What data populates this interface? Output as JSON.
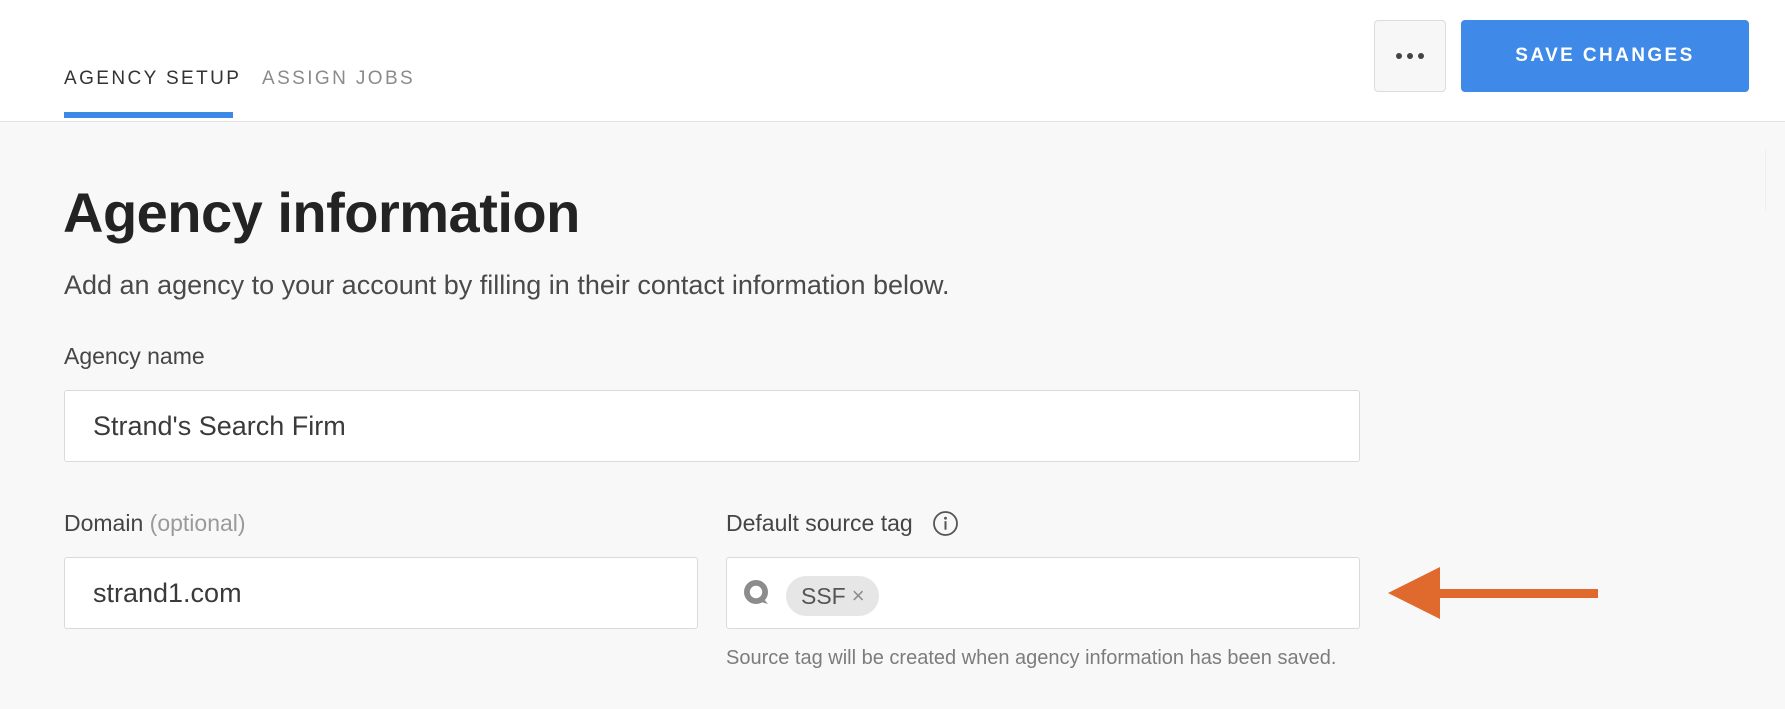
{
  "tabs": [
    {
      "label": "AGENCY SETUP",
      "active": true
    },
    {
      "label": "ASSIGN JOBS",
      "active": false
    }
  ],
  "header": {
    "more_icon": "ellipsis-horizontal-icon",
    "save_label": "SAVE CHANGES"
  },
  "main": {
    "title": "Agency information",
    "subtitle": "Add an agency to your account by filling in their contact information below."
  },
  "form": {
    "agency_name": {
      "label": "Agency name",
      "value": "Strand's Search Firm"
    },
    "domain": {
      "label": "Domain",
      "optional_label": "(optional)",
      "value": "strand1.com"
    },
    "source_tag": {
      "label": "Default source tag",
      "field_icon": "search-icon",
      "info_icon": "info-icon",
      "tags": [
        {
          "label": "SSF",
          "remove_icon": "close-icon",
          "remove_glyph": "×"
        }
      ],
      "helper_text": "Source tag will be created when agency information has been saved."
    }
  },
  "annotation": {
    "icon": "arrow-left-icon",
    "color": "#e06a2e"
  },
  "colors": {
    "accent": "#3f8ae8",
    "background": "#f8f8f8",
    "chip": "#e6e6e6"
  }
}
